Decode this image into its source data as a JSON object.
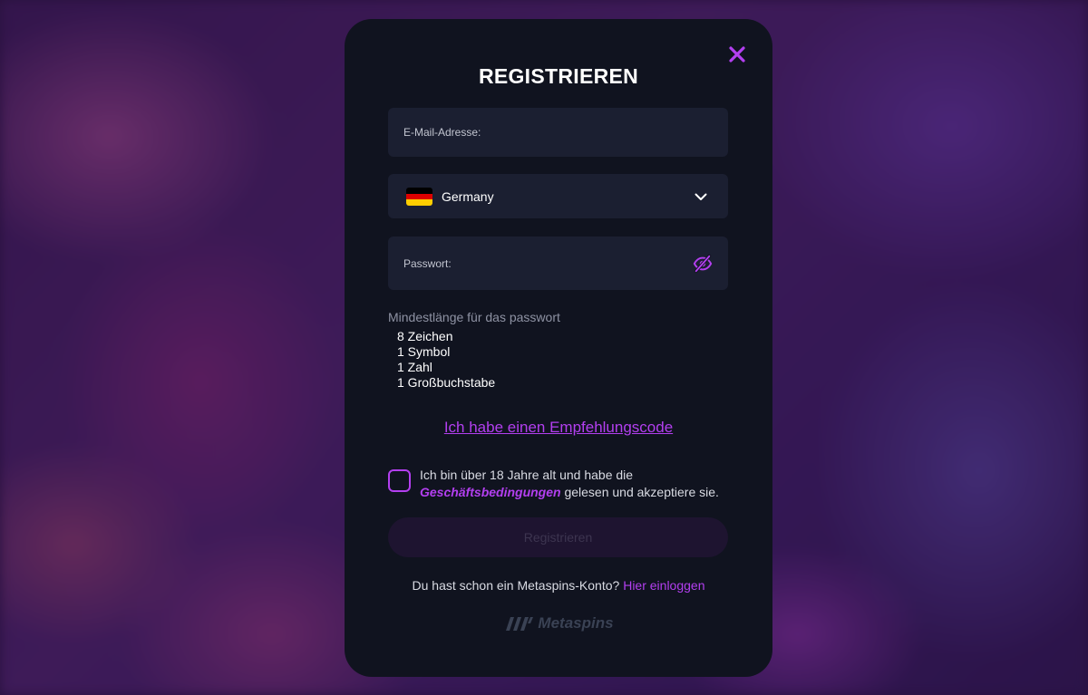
{
  "modal": {
    "title": "REGISTRIEREN",
    "close_icon": "close-icon",
    "accent_color": "#b33ff0"
  },
  "email": {
    "label": "E-Mail-Adresse:",
    "value": ""
  },
  "country": {
    "value": "Germany",
    "flag_icon": "germany-flag-icon",
    "flag_colors": [
      "#000000",
      "#dd0000",
      "#ffce00"
    ]
  },
  "password": {
    "label": "Passwort:",
    "value": "",
    "toggle_icon": "eye-slash-icon"
  },
  "password_rules": {
    "title": "Mindestlänge für das passwort",
    "items": [
      "8 Zeichen",
      "1 Symbol",
      "1 Zahl",
      "1 Großbuchstabe"
    ]
  },
  "referral": {
    "label": "Ich habe einen Empfehlungscode"
  },
  "terms": {
    "checked": false,
    "text_before": "Ich bin über 18 Jahre alt und habe die ",
    "link_text": "Geschäftsbedingungen",
    "text_after": " gelesen und akzeptiere sie."
  },
  "register_button": {
    "label": "Registrieren"
  },
  "login": {
    "prompt": "Du hast schon ein Metaspins-Konto?",
    "link_text": "Hier einloggen"
  },
  "brand": {
    "name": "Metaspins",
    "logo_icon": "metaspins-logo-icon"
  }
}
